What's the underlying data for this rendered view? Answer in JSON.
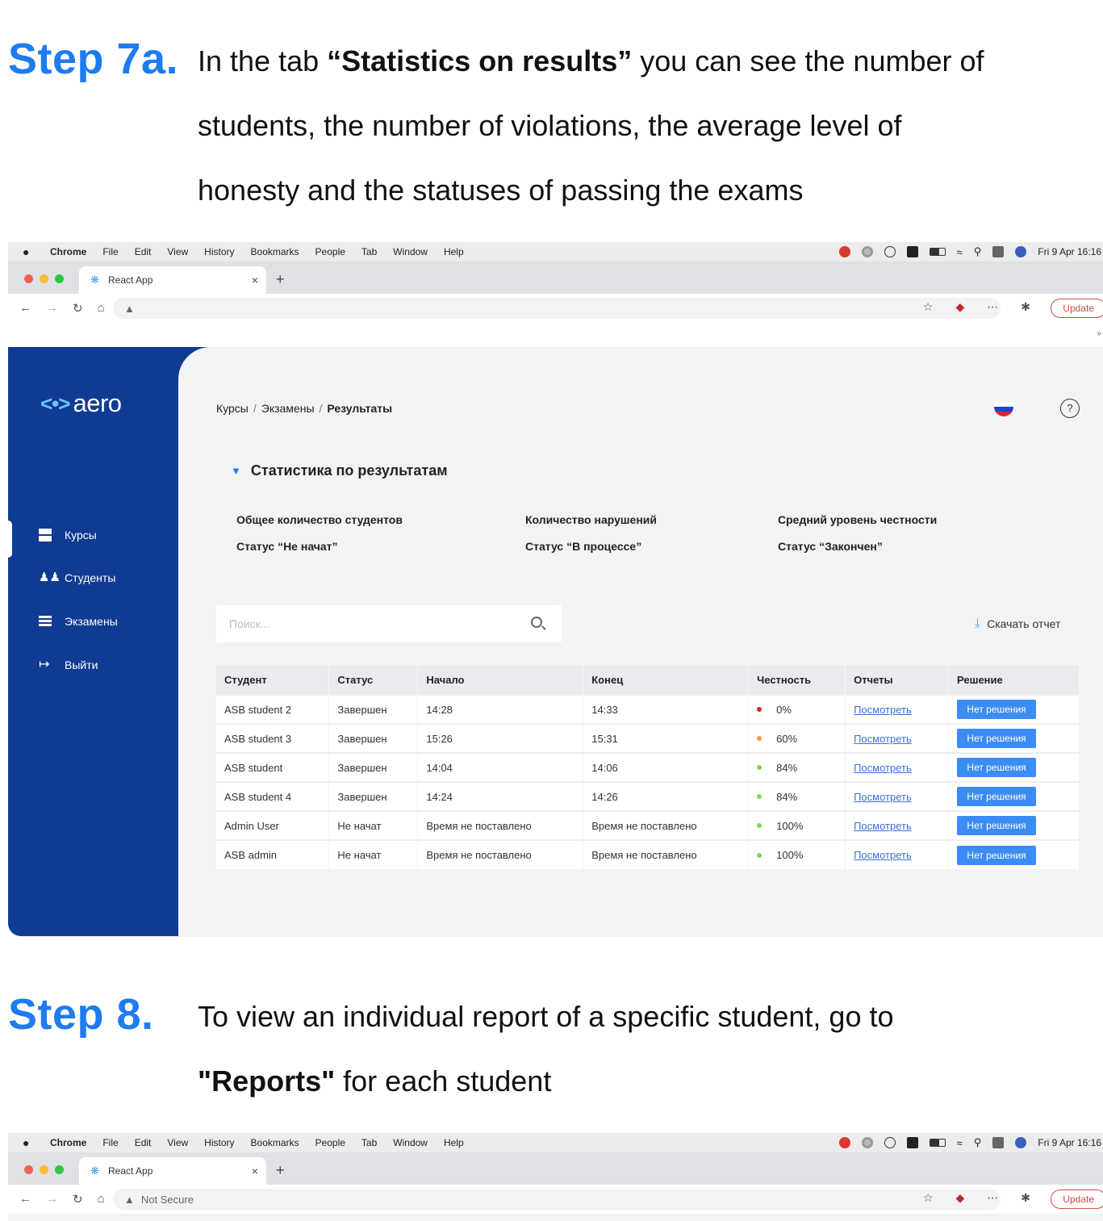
{
  "step7a": {
    "number": "Step 7a.",
    "line1_prefix": "In the tab ",
    "line1_bold": "“Statistics on results”",
    "line1_suffix": " you can see the number of",
    "line2": "students, the number of violations, the average level of",
    "line3": "honesty and the statuses of passing the exams"
  },
  "step8": {
    "number": "Step 8.",
    "line1": "To view an individual report of a specific student, go to",
    "line2_bold": "\"Reports\"",
    "line2_suffix": " for each student"
  },
  "mac_menu": {
    "app": "Chrome",
    "items": [
      "File",
      "Edit",
      "View",
      "History",
      "Bookmarks",
      "People",
      "Tab",
      "Window",
      "Help"
    ],
    "datetime": "Fri 9 Apr  16:16"
  },
  "browser": {
    "tab_title": "React App",
    "tab_close": "×",
    "new_tab": "+",
    "address_secure_label": "Not Secure",
    "update_label": "Update",
    "more_icon": "»"
  },
  "app": {
    "logo_mark": "<•>",
    "logo_text": "aero",
    "sidebar": [
      {
        "label": "Курсы",
        "icon": "courses-icon"
      },
      {
        "label": "Студенты",
        "icon": "students-icon"
      },
      {
        "label": "Экзамены",
        "icon": "exams-icon"
      },
      {
        "label": "Выйти",
        "icon": "exit-icon"
      }
    ],
    "breadcrumb": [
      "Курсы",
      "Экзамены",
      "Результаты"
    ],
    "help_label": "?",
    "stats_title": "Статистика по результатам",
    "stats": {
      "total_students": "Общее количество студентов",
      "violations": "Количество нарушений",
      "avg_honesty": "Средний уровень честности",
      "status_not_started": "Статус “Не начат”",
      "status_in_progress": "Статус “В процессе”",
      "status_finished": "Статус “Закончен”"
    },
    "search_placeholder": "Поиск...",
    "download_label": "Скачать отчет",
    "table": {
      "headers": [
        "Студент",
        "Статус",
        "Начало",
        "Конец",
        "Честность",
        "Отчеты",
        "Решение"
      ],
      "rows": [
        {
          "student": "ASB student 2",
          "status": "Завершен",
          "start": "14:28",
          "end": "14:33",
          "honesty": "0%",
          "honesty_color": "#e02424",
          "report": "Посмотреть",
          "decision": "Нет решения"
        },
        {
          "student": "ASB student 3",
          "status": "Завершен",
          "start": "15:26",
          "end": "15:31",
          "honesty": "60%",
          "honesty_color": "#f0a030",
          "report": "Посмотреть",
          "decision": "Нет решения"
        },
        {
          "student": "ASB student",
          "status": "Завершен",
          "start": "14:04",
          "end": "14:06",
          "honesty": "84%",
          "honesty_color": "#7ed957",
          "report": "Посмотреть",
          "decision": "Нет решения"
        },
        {
          "student": "ASB student 4",
          "status": "Завершен",
          "start": "14:24",
          "end": "14:26",
          "honesty": "84%",
          "honesty_color": "#7ed957",
          "report": "Посмотреть",
          "decision": "Нет решения"
        },
        {
          "student": "Admin User",
          "status": "Не начат",
          "start": "Время не поставлено",
          "end": "Время не поставлено",
          "honesty": "100%",
          "honesty_color": "#7ed957",
          "report": "Посмотреть",
          "decision": "Нет решения"
        },
        {
          "student": "ASB admin",
          "status": "Не начат",
          "start": "Время не поставлено",
          "end": "Время не поставлено",
          "honesty": "100%",
          "honesty_color": "#7ed957",
          "report": "Посмотреть",
          "decision": "Нет решения"
        }
      ]
    }
  },
  "colors": {
    "accent": "#1e7bf0",
    "sidebar": "#103b92",
    "button": "#3c8cf5"
  }
}
